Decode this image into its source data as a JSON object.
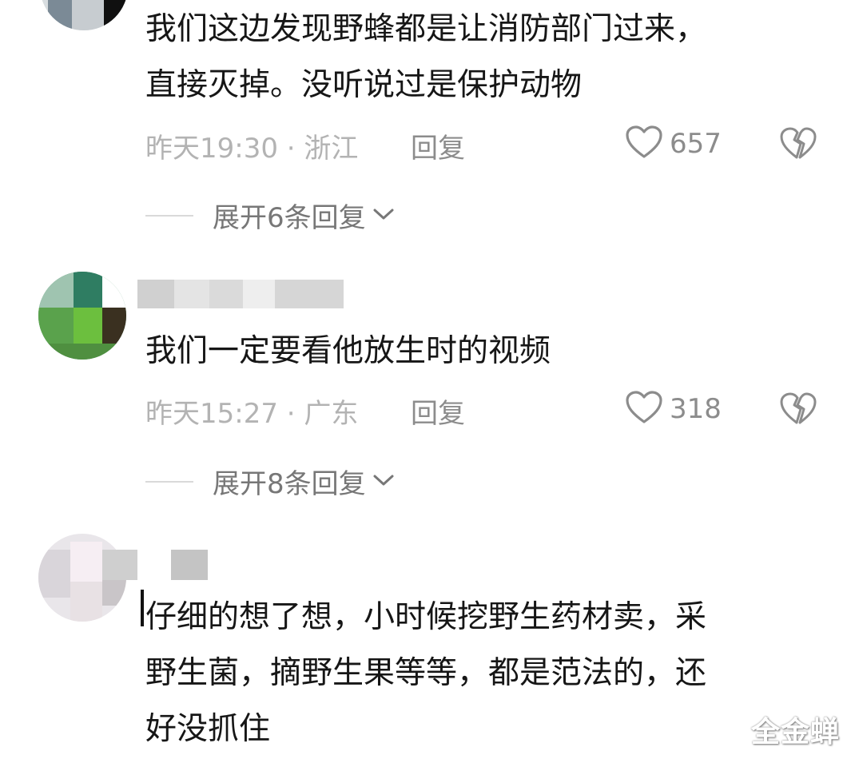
{
  "comments": [
    {
      "text_lines": [
        "我们这边发现野蜂都是让消防部门过来，",
        "直接灭掉。没听说过是保护动物"
      ],
      "time": "昨天19:30 · 浙江",
      "reply_label": "回复",
      "likes": "657",
      "expand_label": "展开6条回复"
    },
    {
      "text_lines": [
        "我们一定要看他放生时的视频"
      ],
      "time": "昨天15:27 · 广东",
      "reply_label": "回复",
      "likes": "318",
      "expand_label": "展开8条回复"
    },
    {
      "text_lines": [
        "仔细的想了想，小时候挖野生药材卖，采",
        "野生菌，摘野生果等等，都是范法的，还",
        "好没抓住"
      ]
    }
  ],
  "watermark": "全金蝉",
  "icons": {
    "like": "heart-outline-icon",
    "dislike": "broken-heart-icon",
    "expand": "chevron-down-icon"
  },
  "colors": {
    "text": "#161616",
    "meta": "#b3b3b3",
    "action": "#8c8c8c"
  }
}
